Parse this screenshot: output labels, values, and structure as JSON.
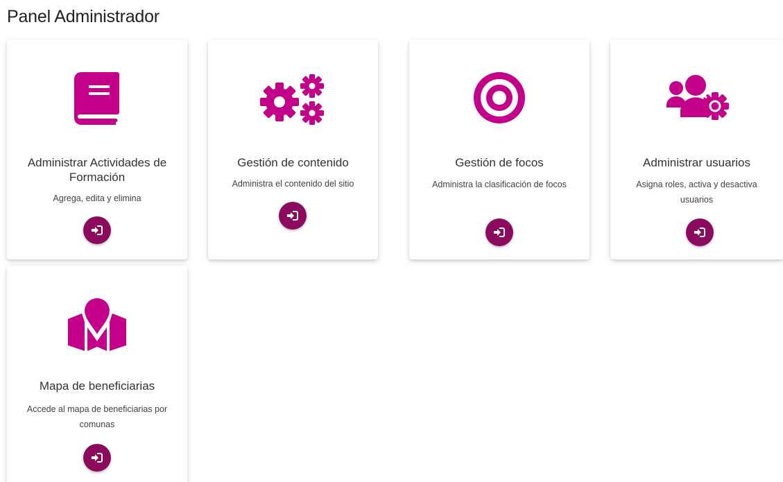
{
  "page": {
    "title": "Panel Administrador"
  },
  "colors": {
    "icon": "#c4008a",
    "button": "#8b0a5e"
  },
  "cards": [
    {
      "icon": "book-icon",
      "title": "Administrar Actividades de Formación",
      "description": "Agrega, edita y elimina",
      "button_icon": "sign-in-icon"
    },
    {
      "icon": "gears-icon",
      "title": "Gestión de contenido",
      "description": "Administra el contenido del sitio",
      "button_icon": "sign-in-icon"
    },
    {
      "icon": "target-icon",
      "title": "Gestión de focos",
      "description": "Administra la clasificación de focos",
      "button_icon": "sign-in-icon"
    },
    {
      "icon": "users-cog-icon",
      "title": "Administrar usuarios",
      "description": "Asigna roles, activa y desactiva usuarios",
      "button_icon": "sign-in-icon"
    },
    {
      "icon": "map-marker-icon",
      "title": "Mapa de beneficiarias",
      "description": "Accede al mapa de beneficiarias por comunas",
      "button_icon": "sign-in-icon"
    }
  ]
}
